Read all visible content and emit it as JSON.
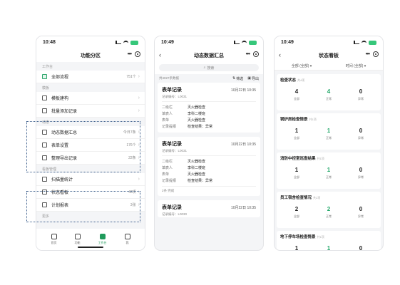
{
  "phone1": {
    "time": "10:48",
    "title": "功能分区",
    "sections": [
      {
        "label": "工作台",
        "rows": [
          {
            "label": "全部流程",
            "count": "751个",
            "icon": "list-icon"
          }
        ]
      },
      {
        "label": "模板",
        "rows": [
          {
            "label": "模板建构",
            "count": "",
            "icon": "template-icon"
          },
          {
            "label": "批量添加记录",
            "count": "",
            "icon": "batch-icon"
          }
        ]
      },
      {
        "label": "动态",
        "rows": [
          {
            "label": "动态数据汇总",
            "count": "今日7条",
            "icon": "summary-icon"
          },
          {
            "label": "表单设置",
            "count": "176个",
            "icon": "form-icon"
          },
          {
            "label": "整理导出记录",
            "count": "22条",
            "icon": "export-icon"
          }
        ]
      },
      {
        "label": "看板管理",
        "rows": [
          {
            "label": "扫描量统计",
            "count": "",
            "icon": "scan-icon"
          },
          {
            "label": "状态看板",
            "count": "48项",
            "icon": "board-icon"
          },
          {
            "label": "计划报表",
            "count": "3张",
            "icon": "report-icon"
          }
        ]
      }
    ],
    "footer_label": "更多",
    "tabs": [
      {
        "label": "首页",
        "active": false
      },
      {
        "label": "功能",
        "active": false
      },
      {
        "label": "工作台",
        "active": true
      },
      {
        "label": "我",
        "active": false
      }
    ]
  },
  "phone2": {
    "time": "10:49",
    "title": "动态数据汇总",
    "search_placeholder": "搜索",
    "count_text": "共4027条数据",
    "tools": [
      "筛选",
      "导出"
    ],
    "cards": [
      {
        "title": "表单记录",
        "time": "10月22日 10:35",
        "id": "记录编号：L0031",
        "fields": [
          {
            "k": "二级栏",
            "v": "灭火器检查"
          },
          {
            "k": "填表人",
            "v": "李科二楼班"
          },
          {
            "k": "表单",
            "v": "灭火器检查"
          },
          {
            "k": "记录提报",
            "v": "检查结果：异常"
          }
        ],
        "foot": ""
      },
      {
        "title": "表单记录",
        "time": "10月22日 10:35",
        "id": "记录编号：L0031",
        "fields": [
          {
            "k": "二级栏",
            "v": "灭火器检查"
          },
          {
            "k": "填表人",
            "v": "李科二楼班"
          },
          {
            "k": "表单",
            "v": "灭火器检查"
          },
          {
            "k": "记录提报",
            "v": "检查结果：异常"
          }
        ],
        "foot": "2条 完成"
      },
      {
        "title": "表单记录",
        "time": "10月22日 10:35",
        "id": "记录编号：L0030",
        "fields": [],
        "foot": ""
      }
    ]
  },
  "phone3": {
    "time": "10:49",
    "title": "状态看板",
    "filters": [
      "全部 (全部) ▾",
      "时间 (全部) ▾"
    ],
    "cards": [
      {
        "title": "检查状态",
        "note": "共4项",
        "stats": [
          {
            "num": "4",
            "label": "全部"
          },
          {
            "num": "4",
            "label": "正常"
          },
          {
            "num": "0",
            "label": "异常"
          }
        ]
      },
      {
        "title": "锅炉房检查情景",
        "note": "共1项",
        "stats": [
          {
            "num": "1",
            "label": "全部"
          },
          {
            "num": "1",
            "label": "正常"
          },
          {
            "num": "0",
            "label": "异常"
          }
        ]
      },
      {
        "title": "消防中控室巡查结果",
        "note": "共1项",
        "stats": [
          {
            "num": "1",
            "label": "全部"
          },
          {
            "num": "1",
            "label": "正常"
          },
          {
            "num": "0",
            "label": "异常"
          }
        ]
      },
      {
        "title": "员工宿舍检查情况",
        "note": "共2项",
        "stats": [
          {
            "num": "2",
            "label": "全部"
          },
          {
            "num": "2",
            "label": "正常"
          },
          {
            "num": "0",
            "label": "异常"
          }
        ]
      },
      {
        "title": "地下停车场检查情景",
        "note": "共1项",
        "stats": [
          {
            "num": "1",
            "label": "全部"
          },
          {
            "num": "1",
            "label": "正常"
          },
          {
            "num": "0",
            "label": "异常"
          }
        ]
      }
    ]
  }
}
